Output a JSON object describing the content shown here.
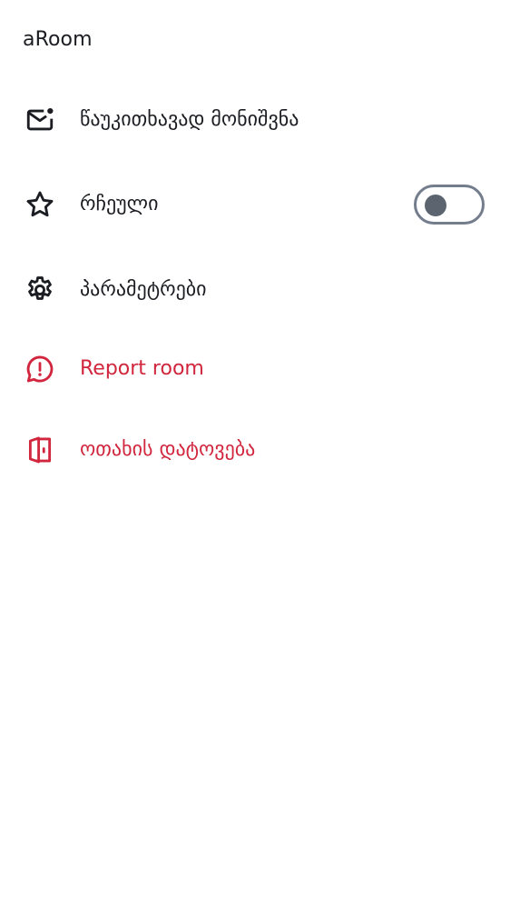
{
  "room": {
    "title": "aRoom"
  },
  "menu": {
    "mark_unread": {
      "label": "წაუკითხავად მონიშვნა",
      "icon": "mail-unread-icon"
    },
    "favourite": {
      "label": "რჩეული",
      "icon": "star-icon",
      "toggle_on": false
    },
    "settings": {
      "label": "პარამეტრები",
      "icon": "gear-icon"
    },
    "report": {
      "label": "Report room",
      "icon": "report-icon"
    },
    "leave": {
      "label": "ოთახის დატოვება",
      "icon": "leave-door-icon"
    }
  },
  "colors": {
    "text": "#1b1d22",
    "danger": "#d1263d",
    "toggle_border": "#737d8c",
    "toggle_knob": "#5c6470",
    "background": "#ffffff"
  }
}
